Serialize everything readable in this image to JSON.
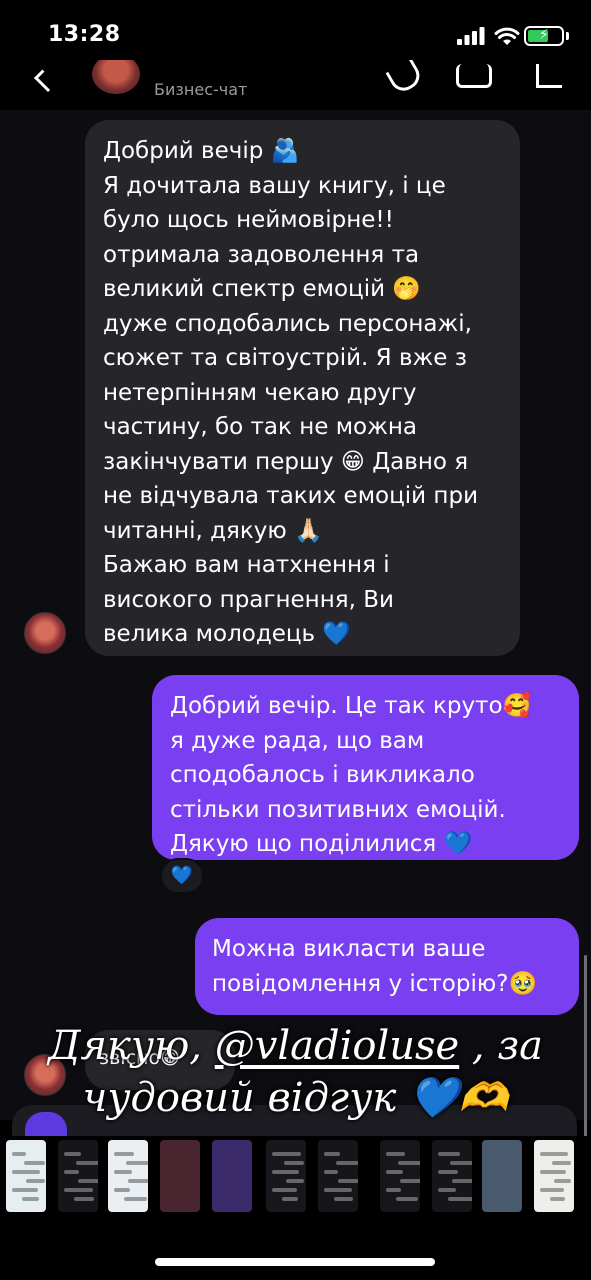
{
  "status_bar": {
    "time": "13:28"
  },
  "header": {
    "subtitle": "Бизнес-чат"
  },
  "messages": [
    {
      "type": "incoming",
      "lines": [
        "Добрий вечір 🫂",
        "Я дочитала вашу книгу, і це",
        "було щось неймовірне!!",
        "отримала задоволення та",
        "великий спектр емоцій 🤭",
        "дуже сподобались персонажі,",
        "сюжет та світоустрій. Я вже з",
        "нетерпінням чекаю другу",
        "частину, бо так не можна",
        "закінчувати першу 😁 Давно я",
        "не відчувала таких емоцій при",
        "читанні, дякую 🙏🏻",
        "Бажаю вам натхнення і",
        "високого прагнення, Ви",
        "велика молодець 💙"
      ]
    },
    {
      "type": "outgoing",
      "lines": [
        "Добрий вечір. Це так круто🥰",
        "я дуже рада, що вам",
        "сподобалось і викликало",
        "стільки позитивних емоцій.",
        "Дякую що поділилися 💙"
      ],
      "reaction": "💙"
    },
    {
      "type": "outgoing",
      "lines": [
        "Можна викласти ваше",
        "повідомлення у історію?🥹"
      ]
    },
    {
      "type": "incoming",
      "text": "звісно😁"
    }
  ],
  "story_caption": {
    "line1_prefix": "Дякую, ",
    "handle": "@vladioluse",
    "line1_suffix": " , за",
    "line2": "чудовий відгук 💙🫶"
  },
  "thumbnails": [
    {
      "theme": "light",
      "color": "#e6eef2"
    },
    {
      "theme": "dark",
      "color": "#15151a"
    },
    {
      "theme": "light",
      "color": "#e9eff3"
    },
    {
      "theme": "photo",
      "color": "#4a2630"
    },
    {
      "theme": "photo",
      "color": "#3a2a6a"
    },
    {
      "theme": "dark",
      "color": "#17171d"
    },
    {
      "theme": "dark",
      "color": "#15151a"
    },
    {
      "theme": "dark",
      "color": "#16161b"
    },
    {
      "theme": "dark",
      "color": "#15151a"
    },
    {
      "theme": "photo",
      "color": "#4a5a6e"
    },
    {
      "theme": "light",
      "color": "#eeeeea"
    },
    {
      "theme": "light",
      "color": "#e6e6e6"
    }
  ]
}
